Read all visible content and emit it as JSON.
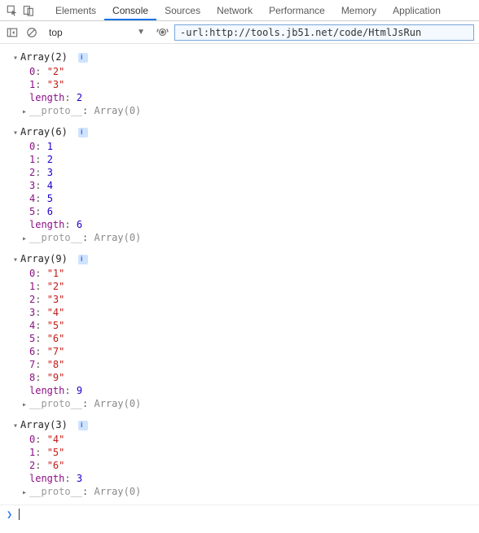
{
  "tabs": {
    "items": [
      "Elements",
      "Console",
      "Sources",
      "Network",
      "Performance",
      "Memory",
      "Application"
    ],
    "activeIndex": 1
  },
  "toolbar": {
    "context": "top",
    "filterValue": "-url:http://tools.jb51.net/code/HtmlJsRun"
  },
  "arrays": [
    {
      "header": "Array(2)",
      "entries": [
        {
          "idx": "0",
          "val": "\"2\"",
          "type": "str"
        },
        {
          "idx": "1",
          "val": "\"3\"",
          "type": "str"
        }
      ],
      "length": "2",
      "proto": "Array(0)"
    },
    {
      "header": "Array(6)",
      "entries": [
        {
          "idx": "0",
          "val": "1",
          "type": "num"
        },
        {
          "idx": "1",
          "val": "2",
          "type": "num"
        },
        {
          "idx": "2",
          "val": "3",
          "type": "num"
        },
        {
          "idx": "3",
          "val": "4",
          "type": "num"
        },
        {
          "idx": "4",
          "val": "5",
          "type": "num"
        },
        {
          "idx": "5",
          "val": "6",
          "type": "num"
        }
      ],
      "length": "6",
      "proto": "Array(0)"
    },
    {
      "header": "Array(9)",
      "entries": [
        {
          "idx": "0",
          "val": "\"1\"",
          "type": "str"
        },
        {
          "idx": "1",
          "val": "\"2\"",
          "type": "str"
        },
        {
          "idx": "2",
          "val": "\"3\"",
          "type": "str"
        },
        {
          "idx": "3",
          "val": "\"4\"",
          "type": "str"
        },
        {
          "idx": "4",
          "val": "\"5\"",
          "type": "str"
        },
        {
          "idx": "5",
          "val": "\"6\"",
          "type": "str"
        },
        {
          "idx": "6",
          "val": "\"7\"",
          "type": "str"
        },
        {
          "idx": "7",
          "val": "\"8\"",
          "type": "str"
        },
        {
          "idx": "8",
          "val": "\"9\"",
          "type": "str"
        }
      ],
      "length": "9",
      "proto": "Array(0)"
    },
    {
      "header": "Array(3)",
      "entries": [
        {
          "idx": "0",
          "val": "\"4\"",
          "type": "str"
        },
        {
          "idx": "1",
          "val": "\"5\"",
          "type": "str"
        },
        {
          "idx": "2",
          "val": "\"6\"",
          "type": "str"
        }
      ],
      "length": "3",
      "proto": "Array(0)"
    }
  ],
  "protoLabel": "__proto__",
  "lengthLabel": "length",
  "promptSymbol": "❯"
}
